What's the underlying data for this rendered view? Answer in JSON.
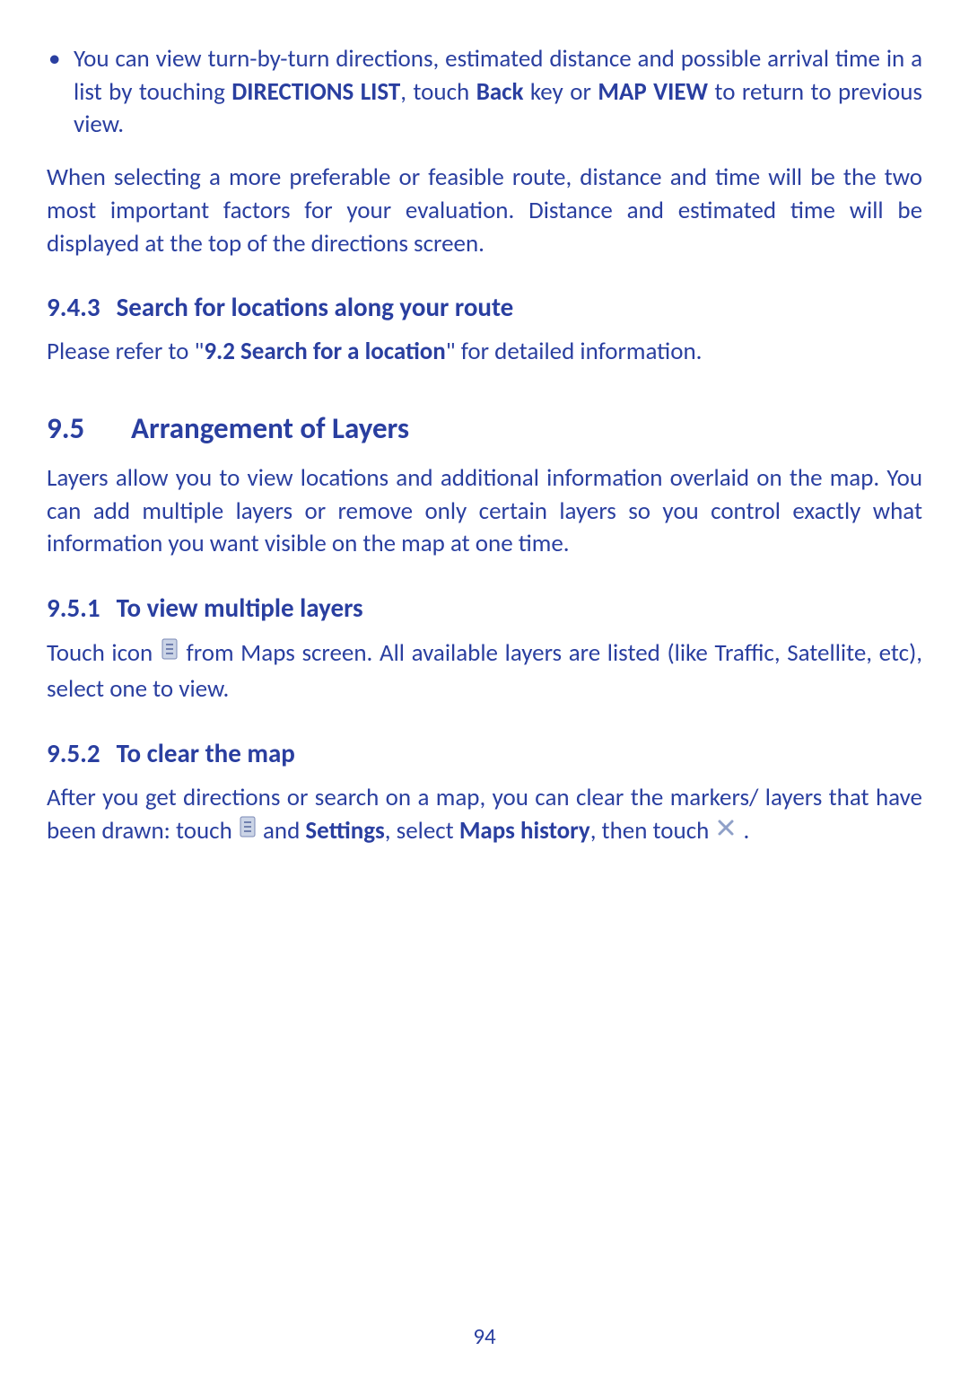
{
  "bullet1": {
    "pre": "You can view turn-by-turn directions, estimated distance and possible arrival time in a list by touching ",
    "b1": "DIRECTIONS LIST",
    "mid1": ", touch ",
    "b2": "Back",
    "mid2": " key or ",
    "b3": "MAP VIEW",
    "post": " to return to previous view."
  },
  "para1": "When selecting a more preferable or feasible route, distance and time will be the two most important factors for your evaluation. Distance and estimated time will be displayed at the top of the directions screen.",
  "h943": {
    "num": "9.4.3",
    "title": "Search for locations along your route"
  },
  "para2": {
    "pre": "Please refer to \"",
    "b1": "9.2 Search for a location",
    "post": "\" for detailed information."
  },
  "h95": {
    "num": "9.5",
    "title": "Arrangement of Layers"
  },
  "para3": "Layers allow you to view locations and additional information overlaid on the map. You can add multiple layers or remove only certain layers so you control exactly what information you want visible on the map at one time.",
  "h951": {
    "num": "9.5.1",
    "title": "To view multiple layers"
  },
  "para4": {
    "pre": "Touch icon ",
    "post": " from Maps screen. All available layers are listed (like Traffic, Satellite, etc), select one to view."
  },
  "h952": {
    "num": "9.5.2",
    "title": "To clear the map"
  },
  "para5": {
    "pre": "After you get directions or search on a map, you can clear the markers/ layers that have been drawn: touch ",
    "mid1": " and ",
    "b1": "Settings",
    "mid2": ", select ",
    "b2": "Maps history",
    "mid3": ", then touch ",
    "post": " ."
  },
  "page_number": "94"
}
